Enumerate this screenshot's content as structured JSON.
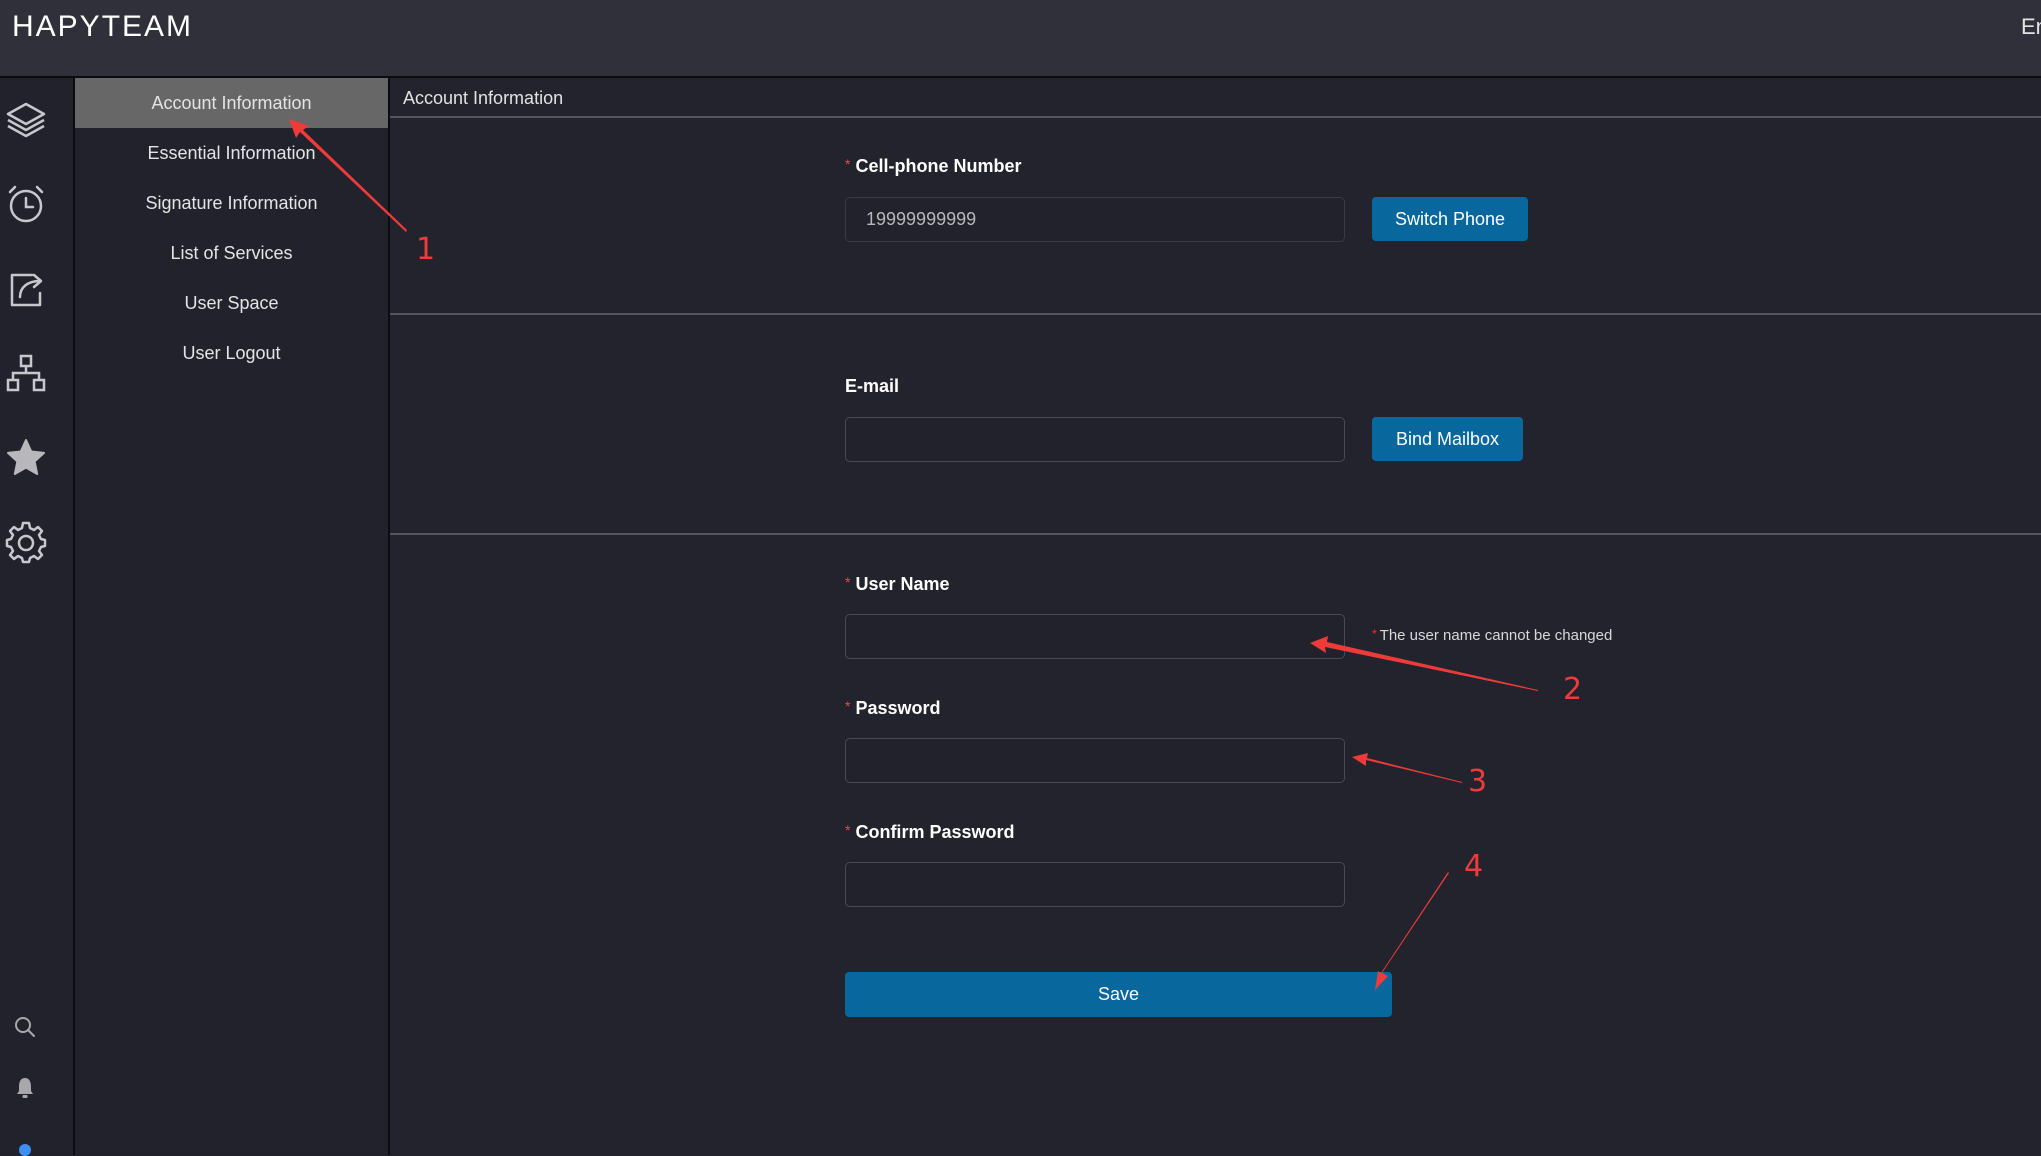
{
  "header": {
    "brand": "HAPYTEAM",
    "language": "En"
  },
  "iconbar": {
    "icons": [
      "layers-icon",
      "alarm-clock-icon",
      "share-icon",
      "org-chart-icon",
      "star-icon",
      "gear-icon"
    ],
    "bottom_icons": [
      "search-icon",
      "bell-icon",
      "status-dot"
    ],
    "status_dot_color": "#3d8ef5"
  },
  "menu": {
    "items": [
      {
        "label": "Account Information",
        "active": true
      },
      {
        "label": "Essential Information",
        "active": false
      },
      {
        "label": "Signature Information",
        "active": false
      },
      {
        "label": "List of Services",
        "active": false
      },
      {
        "label": "User Space",
        "active": false
      },
      {
        "label": "User Logout",
        "active": false
      }
    ]
  },
  "main": {
    "title": "Account Information",
    "phone": {
      "required_mark": "*",
      "label": "Cell-phone Number",
      "value": "19999999999",
      "button": "Switch Phone"
    },
    "email": {
      "label": "E-mail",
      "value": "",
      "button": "Bind Mailbox"
    },
    "username": {
      "required_mark": "*",
      "label": "User Name",
      "value": "",
      "hint_mark": "*",
      "hint": "The user name cannot be changed"
    },
    "password": {
      "required_mark": "*",
      "label": "Password",
      "value": ""
    },
    "confirm_password": {
      "required_mark": "*",
      "label": "Confirm Password",
      "value": ""
    },
    "save_button": "Save"
  },
  "colors": {
    "accent": "#08689e",
    "required": "#e24d4d",
    "annotation": "#f03a3a",
    "active_menu": "#676767"
  },
  "annotations": [
    {
      "number": "1",
      "target": "Account Information menu item"
    },
    {
      "number": "2",
      "target": "User Name field"
    },
    {
      "number": "3",
      "target": "Password field"
    },
    {
      "number": "4",
      "target": "Save button"
    }
  ]
}
